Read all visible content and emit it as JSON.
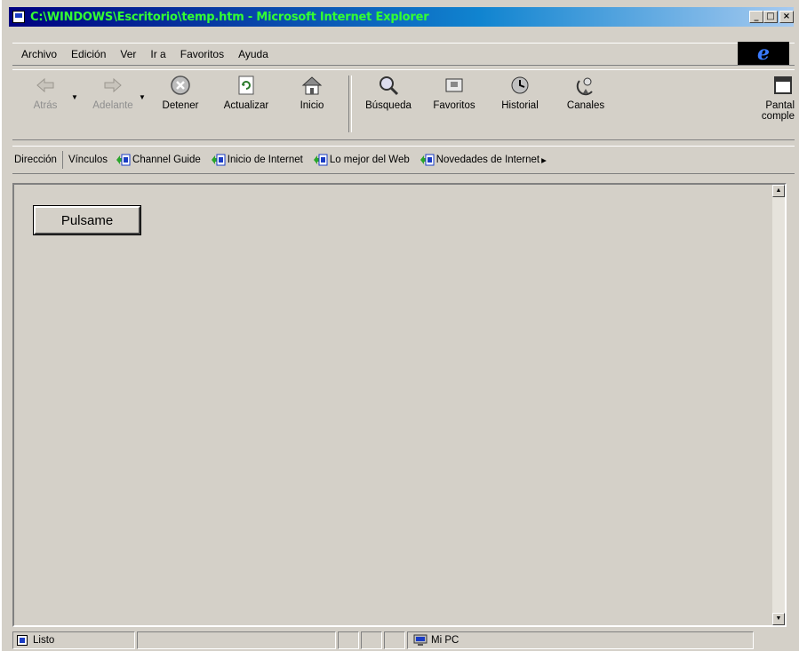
{
  "window": {
    "title": "C:\\WINDOWS\\Escritorio\\temp.htm - Microsoft Internet Explorer",
    "controls": {
      "minimize": "_",
      "maximize": "□",
      "close": "×"
    }
  },
  "menu": {
    "items": [
      "Archivo",
      "Edición",
      "Ver",
      "Ir a",
      "Favoritos",
      "Ayuda"
    ]
  },
  "toolbar": {
    "buttons": [
      {
        "label": "Atrás",
        "icon": "back-arrow-icon",
        "disabled": true
      },
      {
        "label": "Adelante",
        "icon": "forward-arrow-icon",
        "disabled": true
      },
      {
        "label": "Detener",
        "icon": "stop-icon",
        "disabled": false
      },
      {
        "label": "Actualizar",
        "icon": "refresh-icon",
        "disabled": false
      },
      {
        "label": "Inicio",
        "icon": "home-icon",
        "disabled": false
      },
      {
        "label": "Búsqueda",
        "icon": "search-icon",
        "disabled": false
      },
      {
        "label": "Favoritos",
        "icon": "favorites-icon",
        "disabled": false
      },
      {
        "label": "Historial",
        "icon": "history-icon",
        "disabled": false
      },
      {
        "label": "Canales",
        "icon": "channels-icon",
        "disabled": false
      },
      {
        "label": "Pantal",
        "label2": "comple",
        "icon": "fullscreen-icon",
        "disabled": false
      }
    ]
  },
  "addressbar": {
    "label": "Dirección",
    "links_label": "Vínculos",
    "links": [
      "Channel Guide",
      "Inicio de Internet",
      "Lo mejor del Web",
      "Novedades de Internet"
    ],
    "more": "▸"
  },
  "page": {
    "button_label": "Pulsame"
  },
  "status": {
    "text": "Listo",
    "zone": "Mi PC"
  }
}
